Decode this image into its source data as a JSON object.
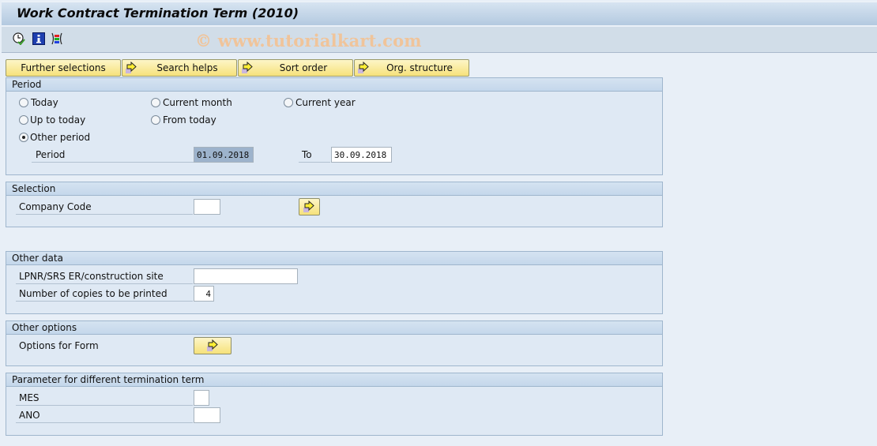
{
  "window": {
    "title": "Work Contract Termination Term (2010)",
    "watermark": "© www.tutorialkart.com"
  },
  "toolbar": {
    "icons": [
      "execute-clock-icon",
      "info-icon",
      "selection-options-icon"
    ]
  },
  "tabs": [
    {
      "label": "Further selections",
      "icon": null
    },
    {
      "label": "Search helps",
      "icon": "arrow-right-icon"
    },
    {
      "label": "Sort order",
      "icon": "arrow-right-icon"
    },
    {
      "label": "Org. structure",
      "icon": "arrow-right-icon"
    }
  ],
  "period": {
    "title": "Period",
    "options": [
      {
        "label": "Today",
        "selected": false
      },
      {
        "label": "Current month",
        "selected": false
      },
      {
        "label": "Current year",
        "selected": false
      },
      {
        "label": "Up to today",
        "selected": false
      },
      {
        "label": "From today",
        "selected": false
      },
      {
        "label": "Other period",
        "selected": true
      }
    ],
    "period_label": "Period",
    "from_value": "01.09.2018",
    "to_label": "To",
    "to_value": "30.09.2018"
  },
  "selection": {
    "title": "Selection",
    "company_code_label": "Company Code",
    "company_code_value": ""
  },
  "other_data": {
    "title": "Other data",
    "site_label": "LPNR/SRS ER/construction site",
    "site_value": "",
    "copies_label": "Number of copies to be printed",
    "copies_value": "4"
  },
  "other_options": {
    "title": "Other options",
    "form_label": "Options for Form"
  },
  "parameter": {
    "title": "Parameter for different termination term",
    "mes_label": "MES",
    "mes_value": "",
    "ano_label": "ANO",
    "ano_value": ""
  },
  "colors": {
    "button_yellow": "#f6e27a",
    "group_bg": "#dfe9f4",
    "selected_field": "#9db3cc",
    "watermark": "#f0c49a"
  }
}
